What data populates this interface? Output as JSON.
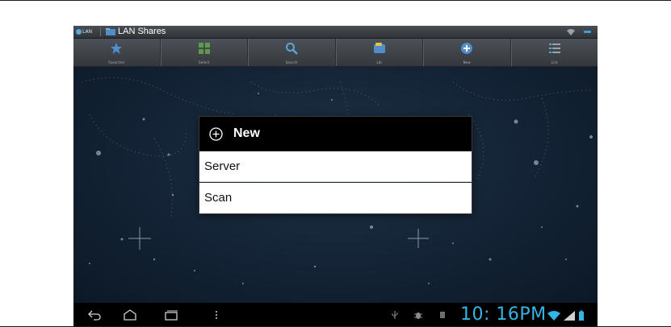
{
  "titlebar": {
    "app_badge": "LAN",
    "title": "LAN Shares",
    "icons": [
      "lan-app-icon",
      "folder-icon",
      "wifi-icon",
      "overflow-menu-icon"
    ]
  },
  "toolbar": {
    "items": [
      {
        "label": "Favorites",
        "icon": "star-icon"
      },
      {
        "label": "Select",
        "icon": "grid-select-icon"
      },
      {
        "label": "Search",
        "icon": "search-icon"
      },
      {
        "label": "Lib",
        "icon": "library-icon"
      },
      {
        "label": "New",
        "icon": "add-circle-icon"
      },
      {
        "label": "List",
        "icon": "list-icon"
      }
    ]
  },
  "dialog": {
    "title": "New",
    "icon": "plus-circle-icon",
    "items": [
      {
        "label": "Server"
      },
      {
        "label": "Scan"
      }
    ]
  },
  "navbar": {
    "clock": "10: 16PM",
    "buttons": [
      "back-icon",
      "home-icon",
      "recent-apps-icon",
      "menu-dots-icon"
    ],
    "status_icons": [
      "usb-icon",
      "debug-icon",
      "sd-card-icon",
      "wifi-icon",
      "signal-icon",
      "battery-icon"
    ]
  },
  "colors": {
    "accent": "#33b5e5",
    "background": "#132335",
    "dialog_header": "#000000",
    "dialog_body": "#ffffff"
  }
}
